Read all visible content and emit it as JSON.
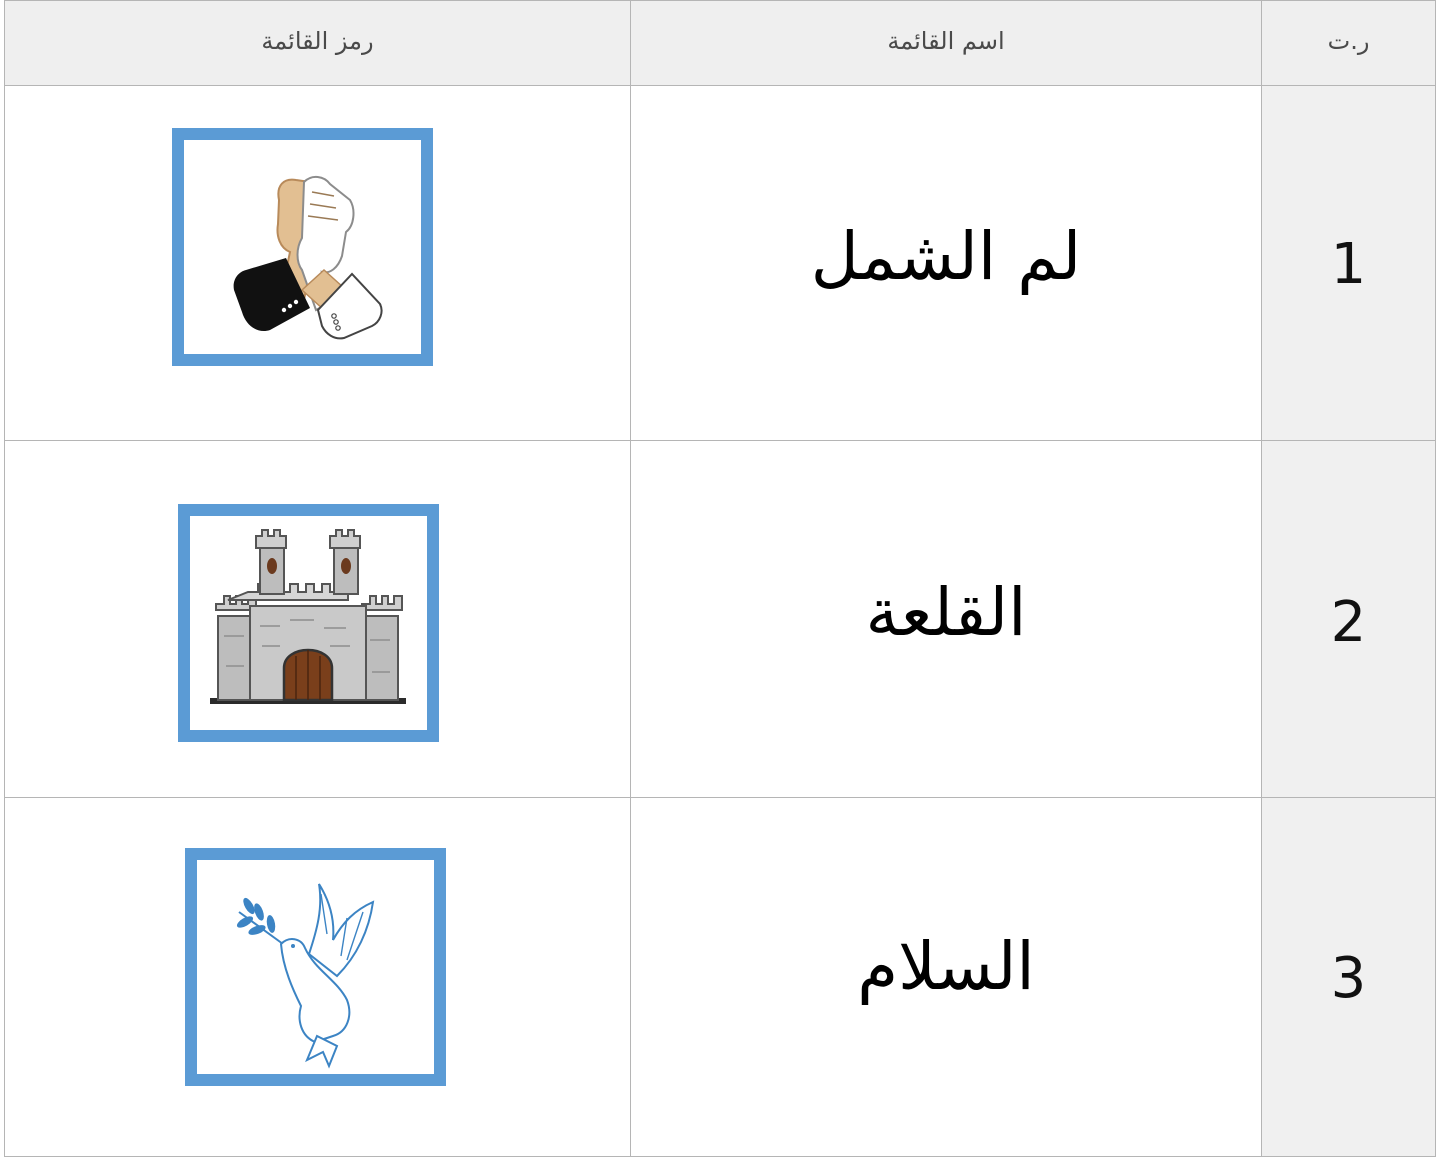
{
  "table": {
    "headers": {
      "number": "ر.ت",
      "name": "اسم القائمة",
      "symbol": "رمز القائمة"
    },
    "rows": [
      {
        "number": "1",
        "name": "لم الشمل",
        "symbol_icon": "handshake-icon"
      },
      {
        "number": "2",
        "name": "القلعة",
        "symbol_icon": "castle-icon"
      },
      {
        "number": "3",
        "name": "السلام",
        "symbol_icon": "dove-icon"
      }
    ]
  },
  "colors": {
    "frame_border": "#5b9bd5",
    "header_bg": "#efefef",
    "number_col_bg": "#f0f0f0",
    "grid_line": "#b5b5b5"
  }
}
